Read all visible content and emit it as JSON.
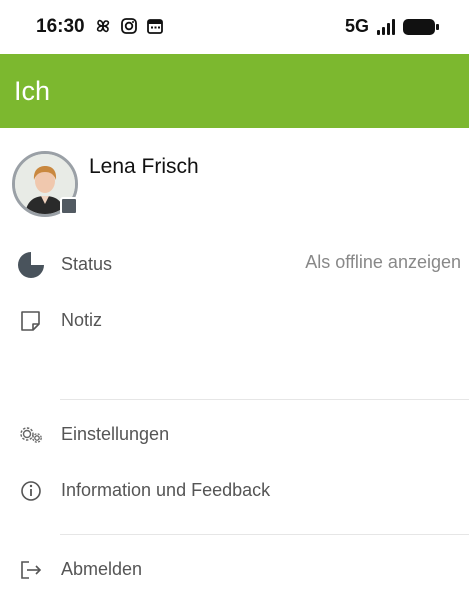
{
  "status_bar": {
    "time": "16:30",
    "network": "5G",
    "icons": [
      "pinwheel-icon",
      "instagram-icon",
      "calendar-icon"
    ]
  },
  "app_bar": {
    "title": "Ich"
  },
  "profile": {
    "name": "Lena Frisch",
    "presence_color": "#525a62"
  },
  "menu": {
    "status_label": "Status",
    "status_value": "Als offline anzeigen",
    "note_label": "Notiz",
    "settings_label": "Einstellungen",
    "info_label": "Information und Feedback",
    "logout_label": "Abmelden"
  },
  "colors": {
    "accent": "#7cb82f",
    "status_icon": "#49535c"
  }
}
